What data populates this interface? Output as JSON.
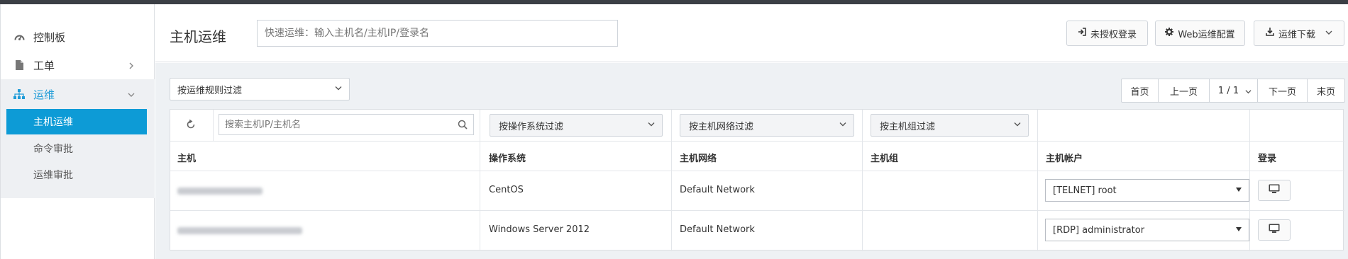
{
  "sidebar": {
    "items": [
      {
        "label": "控制板",
        "icon": "dashboard-icon"
      },
      {
        "label": "工单",
        "icon": "document-icon"
      },
      {
        "label": "运维",
        "icon": "sitemap-icon"
      }
    ],
    "subitems": [
      {
        "label": "主机运维",
        "active": true
      },
      {
        "label": "命令审批"
      },
      {
        "label": "运维审批"
      }
    ]
  },
  "header": {
    "title": "主机运维",
    "quick_placeholder": "快速运维：输入主机名/主机IP/登录名",
    "buttons": {
      "unauthorized_login": "未授权登录",
      "web_config": "Web运维配置",
      "download": "运维下载"
    }
  },
  "filters": {
    "rule_filter": "按运维规则过滤"
  },
  "pager": {
    "first": "首页",
    "prev": "上一页",
    "current": "1 / 1",
    "next": "下一页",
    "last": "末页"
  },
  "table": {
    "search_placeholder": "搜索主机IP/主机名",
    "os_filter": "按操作系统过滤",
    "network_filter": "按主机网络过滤",
    "group_filter": "按主机组过滤",
    "headers": [
      "主机",
      "操作系统",
      "主机网络",
      "主机组",
      "主机帐户",
      "登录"
    ],
    "rows": [
      {
        "os": "CentOS",
        "network": "Default Network",
        "group": "",
        "account": "[TELNET] root"
      },
      {
        "os": "Windows Server 2012",
        "network": "Default Network",
        "group": "",
        "account": "[RDP] administrator"
      }
    ]
  },
  "colors": {
    "accent": "#1e9bd7",
    "active_bg": "#0d9bd6",
    "topbar": "#3b3f45",
    "content_bg": "#eef1f4"
  }
}
